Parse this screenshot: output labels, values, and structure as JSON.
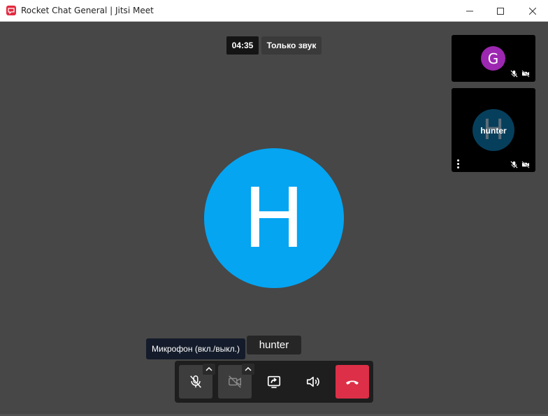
{
  "window": {
    "title": "Rocket Chat General | Jitsi Meet",
    "controls": [
      "minimize-icon",
      "maximize-icon",
      "close-icon"
    ]
  },
  "call": {
    "timer": "04:35",
    "mode_label": "Только звук"
  },
  "main_participant": {
    "initial": "H",
    "name": "hunter",
    "avatar_color": "#05a5f2"
  },
  "thumbnails": [
    {
      "initial": "G",
      "avatar_color": "#9c27b0",
      "muted_icons": [
        "mic-off-icon",
        "camera-off-icon"
      ]
    },
    {
      "initial": "H",
      "name": "hunter",
      "avatar_color": "#063f5c",
      "muted_icons": [
        "mic-off-icon",
        "camera-off-icon"
      ]
    }
  ],
  "tooltip": {
    "text": "Микрофон (вкл./выкл.)"
  },
  "toolbar": {
    "buttons": [
      "mic-off-icon",
      "camera-off-icon",
      "screen-share-icon",
      "volume-icon",
      "hangup-icon"
    ],
    "hangup_color": "#dd2f48"
  }
}
